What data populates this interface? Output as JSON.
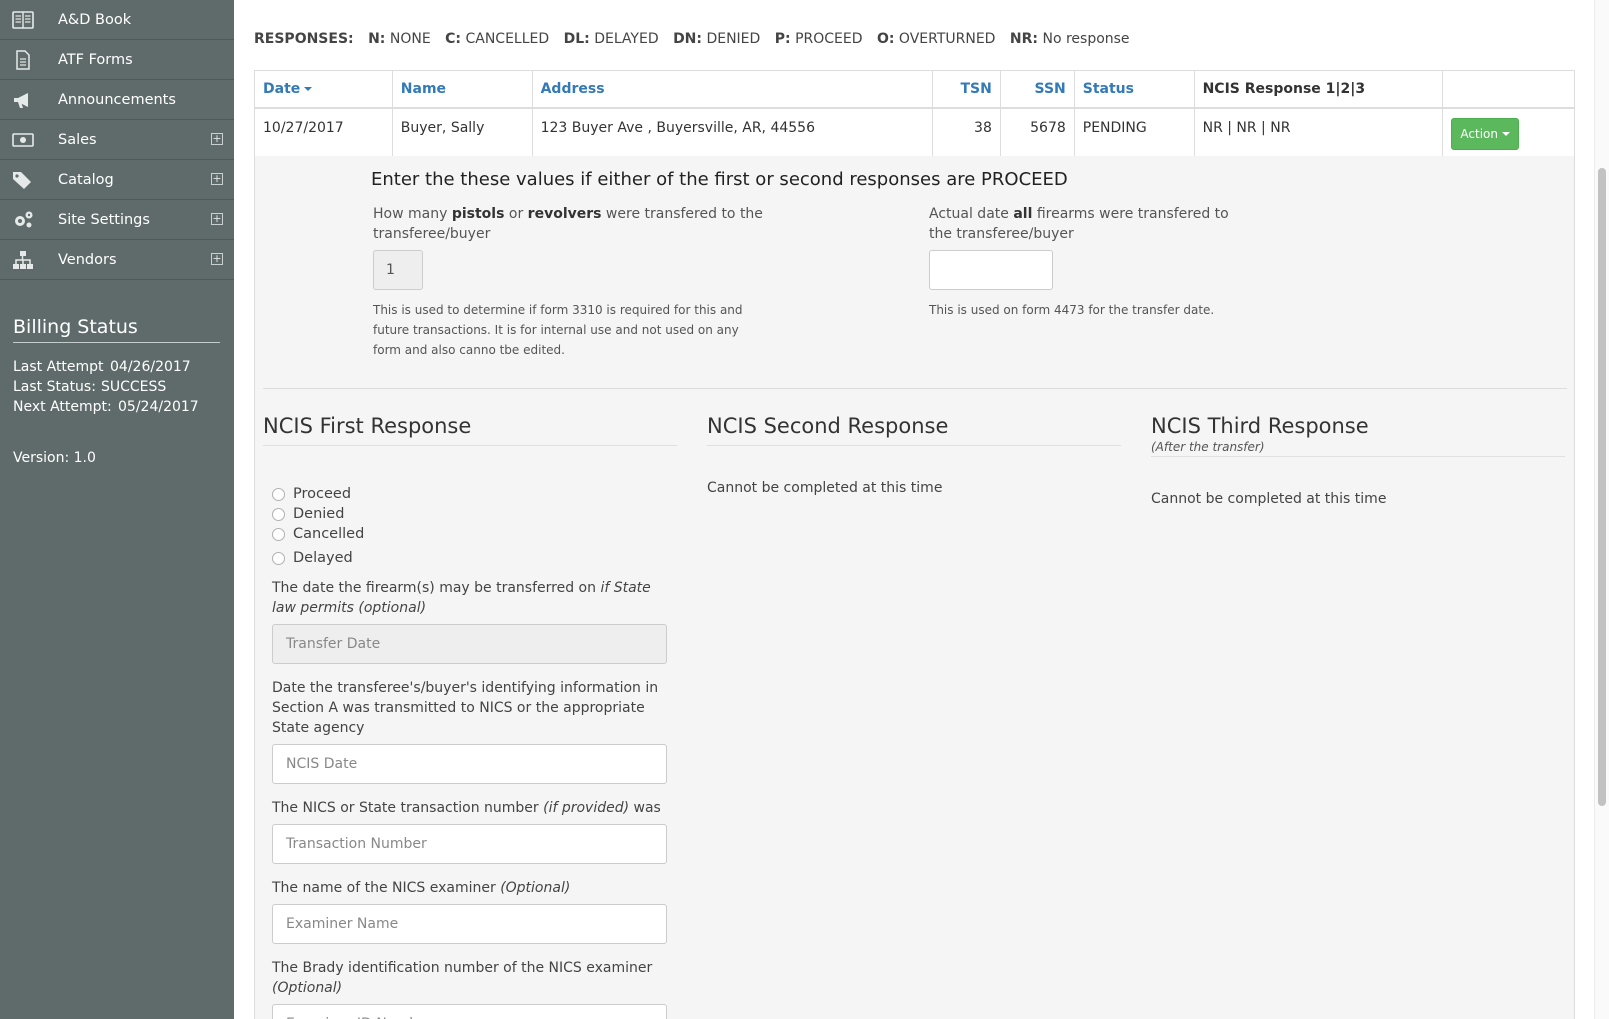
{
  "sidebar": {
    "items": [
      {
        "label": "A&D Book",
        "icon": "book-icon"
      },
      {
        "label": "ATF Forms",
        "icon": "document-icon"
      },
      {
        "label": "Announcements",
        "icon": "megaphone-icon"
      },
      {
        "label": "Sales",
        "icon": "money-icon",
        "expandable": true
      },
      {
        "label": "Catalog",
        "icon": "tags-icon",
        "expandable": true
      },
      {
        "label": "Site Settings",
        "icon": "gears-icon",
        "expandable": true
      },
      {
        "label": "Vendors",
        "icon": "sitemap-icon",
        "expandable": true
      }
    ],
    "billing": {
      "title": "Billing Status",
      "last_attempt_label": "Last Attempt",
      "last_attempt_value": "04/26/2017",
      "last_status_label": "Last Status:",
      "last_status_value": "SUCCESS",
      "next_attempt_label": "Next Attempt:",
      "next_attempt_value": "05/24/2017"
    },
    "version": "Version: 1.0"
  },
  "legend": {
    "title": "RESPONSES:",
    "items": [
      {
        "code": "N:",
        "text": "NONE"
      },
      {
        "code": "C:",
        "text": "CANCELLED"
      },
      {
        "code": "DL:",
        "text": "DELAYED"
      },
      {
        "code": "DN:",
        "text": "DENIED"
      },
      {
        "code": "P:",
        "text": "PROCEED"
      },
      {
        "code": "O:",
        "text": "OVERTURNED"
      },
      {
        "code": "NR:",
        "text": "No response"
      }
    ]
  },
  "table": {
    "headers": {
      "date": "Date",
      "name": "Name",
      "address": "Address",
      "tsn": "TSN",
      "ssn": "SSN",
      "status": "Status",
      "ncis": "NCIS Response 1|2|3"
    },
    "row": {
      "date": "10/27/2017",
      "name": "Buyer, Sally",
      "address": "123 Buyer Ave , Buyersville, AR, 44556",
      "tsn": "38",
      "ssn": "5678",
      "status": "PENDING",
      "ncis": "NR | NR | NR",
      "action": "Action"
    }
  },
  "detail": {
    "instruction": "Enter the these values if either of the first or second responses are PROCEED",
    "pistols": {
      "label_pre": "How many ",
      "label_b1": "pistols",
      "label_mid": " or ",
      "label_b2": "revolvers",
      "label_post": " were transfered to the transferee/buyer",
      "value": "1",
      "help": "This is used to determine if form 3310 is required for this and future transactions. It is for internal use and not used on any form and also canno tbe edited."
    },
    "actual_date": {
      "label_pre": "Actual date ",
      "label_b": "all",
      "label_post": " firearms were transfered to the transferee/buyer",
      "value": "",
      "help": "This is used on form 4473 for the transfer date."
    },
    "first": {
      "title": "NCIS First Response",
      "options": [
        "Proceed",
        "Denied",
        "Cancelled",
        "Delayed"
      ],
      "transfer_label": "The date the firearm(s) may be transferred on ",
      "transfer_label_i": "if State law permits (optional)",
      "transfer_placeholder": "Transfer Date",
      "ncis_label": "Date the transferee's/buyer's identifying information in Section A was transmitted to NICS or the appropriate State agency",
      "ncis_placeholder": "NCIS Date",
      "txn_label": "The NICS or State transaction number ",
      "txn_label_i": "(if provided)",
      "txn_label_post": " was",
      "txn_placeholder": "Transaction Number",
      "examiner_label": "The name of the NICS examiner ",
      "examiner_label_i": "(Optional)",
      "examiner_placeholder": "Examiner Name",
      "brady_label": "The Brady identification number of the NICS examiner ",
      "brady_label_i": "(Optional)",
      "brady_placeholder": "Examiner ID Number"
    },
    "second": {
      "title": "NCIS Second Response",
      "text": "Cannot be completed at this time"
    },
    "third": {
      "title": "NCIS Third Response",
      "subtitle": "(After the transfer)",
      "text": "Cannot be completed at this time"
    }
  }
}
